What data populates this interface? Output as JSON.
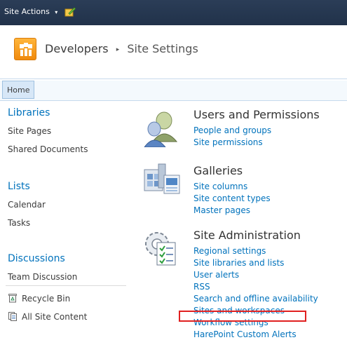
{
  "topbar": {
    "site_actions_label": "Site Actions",
    "site_actions_caret": "▾",
    "edit_icon": "edit-page-icon"
  },
  "header": {
    "site_name": "Developers",
    "separator": "▸",
    "page_title": "Site Settings"
  },
  "topnav": {
    "tabs": [
      {
        "label": "Home"
      }
    ]
  },
  "quicklaunch": {
    "libraries": {
      "heading": "Libraries",
      "items": [
        "Site Pages",
        "Shared Documents"
      ]
    },
    "lists": {
      "heading": "Lists",
      "items": [
        "Calendar",
        "Tasks"
      ]
    },
    "discussions": {
      "heading": "Discussions",
      "items": [
        "Team Discussion"
      ]
    },
    "bottom": [
      {
        "label": "Recycle Bin",
        "icon": "recycle-bin-icon"
      },
      {
        "label": "All Site Content",
        "icon": "all-site-content-icon"
      }
    ]
  },
  "main": {
    "users": {
      "title": "Users and Permissions",
      "links": [
        "People and groups",
        "Site permissions"
      ]
    },
    "galleries": {
      "title": "Galleries",
      "links": [
        "Site columns",
        "Site content types",
        "Master pages"
      ]
    },
    "admin": {
      "title": "Site Administration",
      "links": [
        "Regional settings",
        "Site libraries and lists",
        "User alerts",
        "RSS",
        "Search and offline availability",
        "Sites and workspaces",
        "Workflow settings",
        "HarePoint Custom Alerts"
      ]
    }
  },
  "colors": {
    "link": "#0072bc",
    "topbar": "#2b3d57",
    "highlight": "#e02020"
  }
}
